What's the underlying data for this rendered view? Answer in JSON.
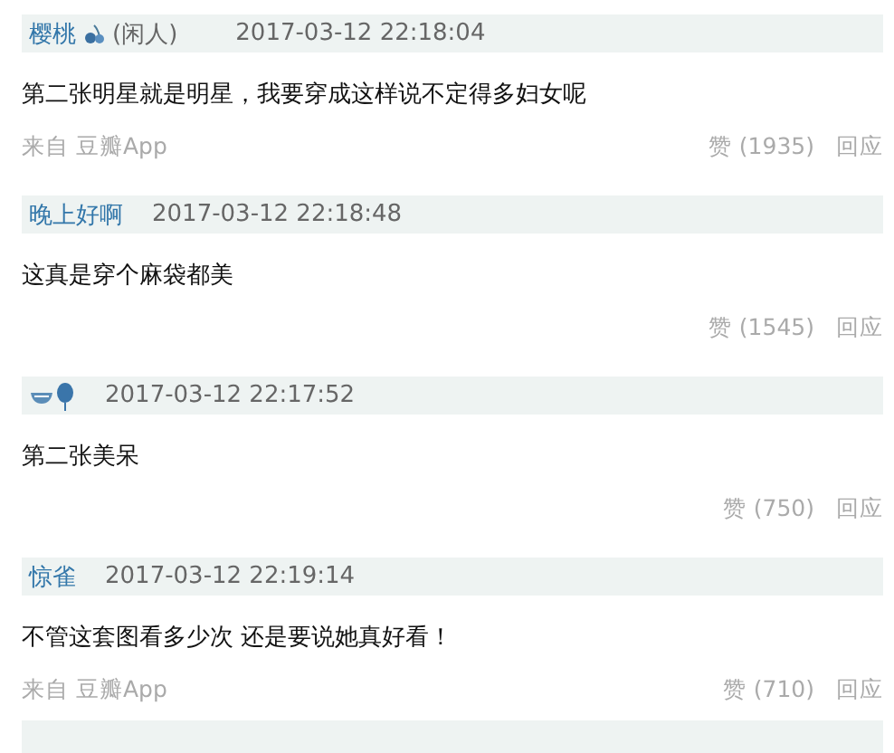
{
  "comments": [
    {
      "author": "樱桃",
      "kind": "cherry",
      "note": "(闲人)",
      "time": "2017-03-12 22:18:04",
      "text": "第二张明星就是明星，我要穿成这样说不定得多妇女呢",
      "source": "来自 豆瓣App",
      "likes": "赞 (1935)",
      "reply": "回应"
    },
    {
      "author": "晚上好啊",
      "time": "2017-03-12 22:18:48",
      "text": "这真是穿个麻袋都美",
      "likes": "赞 (1545)",
      "reply": "回应"
    },
    {
      "kind": "bowl-balloon",
      "time": "2017-03-12 22:17:52",
      "text": "第二张美呆",
      "likes": "赞 (750)",
      "reply": "回应"
    },
    {
      "author": "惊雀",
      "time": "2017-03-12 22:19:14",
      "text": "不管这套图看多少次 还是要说她真好看！",
      "source": "来自 豆瓣App",
      "likes": "赞 (710)",
      "reply": "回应"
    }
  ],
  "partial_header": true
}
